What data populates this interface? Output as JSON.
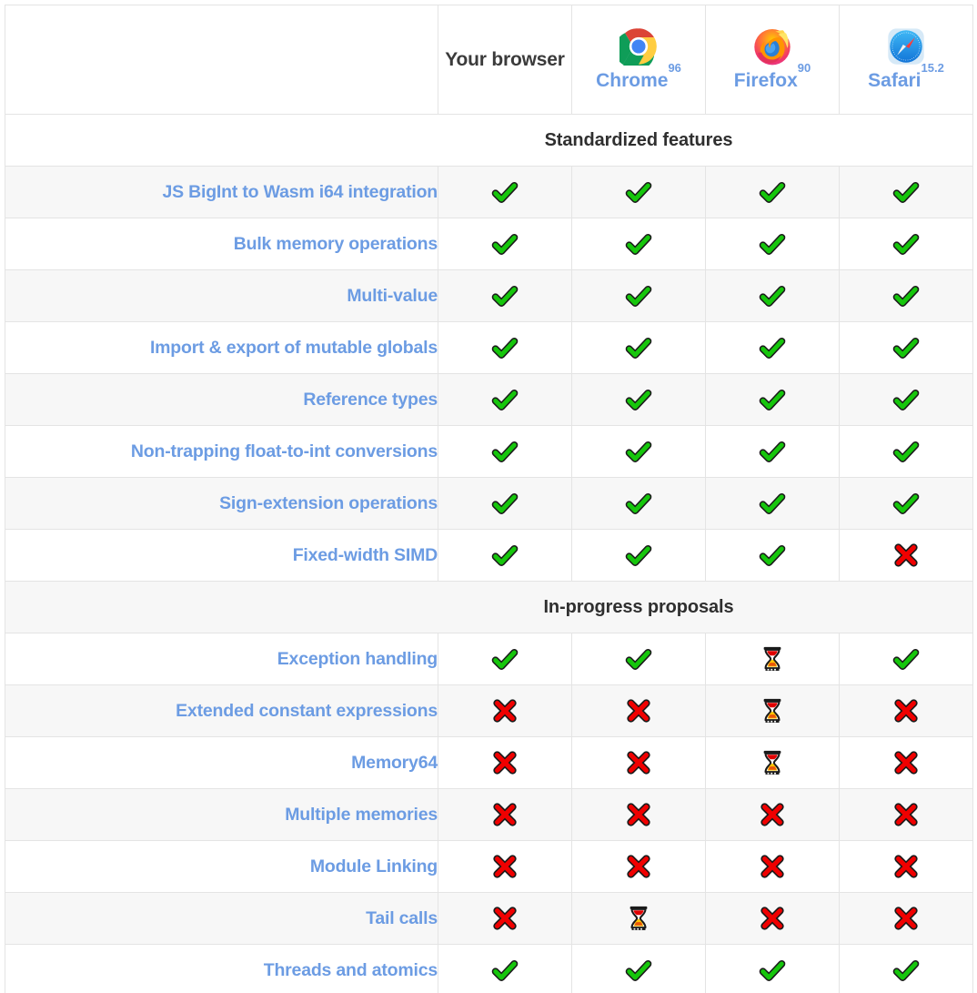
{
  "table": {
    "columns": [
      {
        "key": "feature",
        "label": "",
        "type": "feature"
      },
      {
        "key": "yours",
        "label": "Your browser",
        "type": "ua",
        "icon": "none"
      },
      {
        "key": "chrome",
        "label": "Chrome",
        "version": "96",
        "type": "browser",
        "icon": "chrome-logo"
      },
      {
        "key": "firefox",
        "label": "Firefox",
        "version": "90",
        "type": "browser",
        "icon": "firefox-logo"
      },
      {
        "key": "safari",
        "label": "Safari",
        "version": "15.2",
        "type": "browser",
        "icon": "safari-logo"
      }
    ],
    "sections": [
      {
        "title": "Standardized features",
        "rows": [
          {
            "feature": "JS BigInt to Wasm i64 integration",
            "yours": "yes",
            "chrome": "yes",
            "firefox": "yes",
            "safari": "yes"
          },
          {
            "feature": "Bulk memory operations",
            "yours": "yes",
            "chrome": "yes",
            "firefox": "yes",
            "safari": "yes"
          },
          {
            "feature": "Multi-value",
            "yours": "yes",
            "chrome": "yes",
            "firefox": "yes",
            "safari": "yes"
          },
          {
            "feature": "Import & export of mutable globals",
            "yours": "yes",
            "chrome": "yes",
            "firefox": "yes",
            "safari": "yes"
          },
          {
            "feature": "Reference types",
            "yours": "yes",
            "chrome": "yes",
            "firefox": "yes",
            "safari": "yes"
          },
          {
            "feature": "Non-trapping float-to-int conversions",
            "yours": "yes",
            "chrome": "yes",
            "firefox": "yes",
            "safari": "yes"
          },
          {
            "feature": "Sign-extension operations",
            "yours": "yes",
            "chrome": "yes",
            "firefox": "yes",
            "safari": "yes"
          },
          {
            "feature": "Fixed-width SIMD",
            "yours": "yes",
            "chrome": "yes",
            "firefox": "yes",
            "safari": "no"
          }
        ]
      },
      {
        "title": "In-progress proposals",
        "rows": [
          {
            "feature": "Exception handling",
            "yours": "yes",
            "chrome": "yes",
            "firefox": "pending",
            "safari": "yes"
          },
          {
            "feature": "Extended constant expressions",
            "yours": "no",
            "chrome": "no",
            "firefox": "pending",
            "safari": "no"
          },
          {
            "feature": "Memory64",
            "yours": "no",
            "chrome": "no",
            "firefox": "pending",
            "safari": "no"
          },
          {
            "feature": "Multiple memories",
            "yours": "no",
            "chrome": "no",
            "firefox": "no",
            "safari": "no"
          },
          {
            "feature": "Module Linking",
            "yours": "no",
            "chrome": "no",
            "firefox": "no",
            "safari": "no"
          },
          {
            "feature": "Tail calls",
            "yours": "no",
            "chrome": "pending",
            "firefox": "no",
            "safari": "no"
          },
          {
            "feature": "Threads and atomics",
            "yours": "yes",
            "chrome": "yes",
            "firefox": "yes",
            "safari": "yes"
          }
        ]
      }
    ],
    "status_legend": {
      "yes": "check-mark-icon",
      "no": "cross-mark-icon",
      "pending": "hourglass-icon"
    }
  },
  "colors": {
    "link_blue": "#6c9ce3",
    "heading_text": "#2f2f2f",
    "row_shade": "#f7f7f7",
    "border": "#e4e4e4",
    "check_green": "#16c60c",
    "cross_red": "#f00000",
    "glyph_outline": "#1a1a1a"
  }
}
